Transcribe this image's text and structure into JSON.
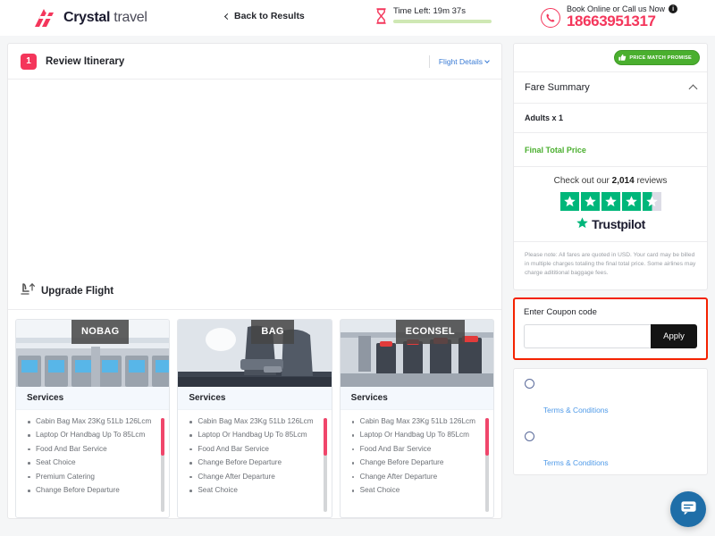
{
  "header": {
    "logo_bold": "Crystal",
    "logo_light": " travel",
    "back_label": "Back to Results",
    "timer_text": "Time Left: 19m 37s",
    "timer_progress": 83,
    "call_label": "Book Online or Call us Now",
    "info_badge": "i",
    "phone": "18663951317",
    "accent_color": "#f4365b",
    "timer_bar_color": "#4caf21"
  },
  "review": {
    "step": "1",
    "title": "Review Itinerary",
    "flight_details_label": "Flight Details"
  },
  "upgrade": {
    "title": "Upgrade Flight",
    "services_heading": "Services",
    "cards": [
      {
        "badge": "NOBAG",
        "services": [
          "Cabin Bag Max 23Kg 51Lb 126Lcm",
          "Laptop Or Handbag Up To 85Lcm",
          "Food And Bar Service",
          "Seat Choice",
          "Premium Catering",
          "Change Before Departure"
        ]
      },
      {
        "badge": "BAG",
        "services": [
          "Cabin Bag Max 23Kg 51Lb 126Lcm",
          "Laptop Or Handbag Up To 85Lcm",
          "Food And Bar Service",
          "Change Before Departure",
          "Change After Departure",
          "Seat Choice"
        ]
      },
      {
        "badge": "ECONSEL",
        "services": [
          "Cabin Bag Max 23Kg 51Lb 126Lcm",
          "Laptop Or Handbag Up To 85Lcm",
          "Food And Bar Service",
          "Change Before Departure",
          "Change After Departure",
          "Seat Choice"
        ]
      }
    ]
  },
  "sidebar": {
    "promise_badge": "PRICE MATCH PROMISE",
    "fare_summary_title": "Fare Summary",
    "adults_label": "Adults x 1",
    "final_total_label": "Final Total Price",
    "trustpilot": {
      "prefix": "Check out our ",
      "reviews_count": "2,014",
      "suffix": " reviews",
      "brand": "Trustpilot",
      "rating": 4.5,
      "star_color": "#00b67a"
    },
    "note": "Please note: All fares are quoted in USD. Your card may be billed in multiple charges totaling the final total price. Some airlines may charge adititional baggage fees.",
    "coupon": {
      "label": "Enter Coupon code",
      "placeholder": "",
      "value": "",
      "apply_label": "Apply",
      "highlight_color": "#f42200"
    },
    "options": [
      {
        "terms_label": "Terms & Conditions"
      },
      {
        "terms_label": "Terms & Conditions"
      }
    ]
  },
  "chat": {
    "icon": "chat-bubble-icon",
    "color": "#1f6ea8"
  }
}
